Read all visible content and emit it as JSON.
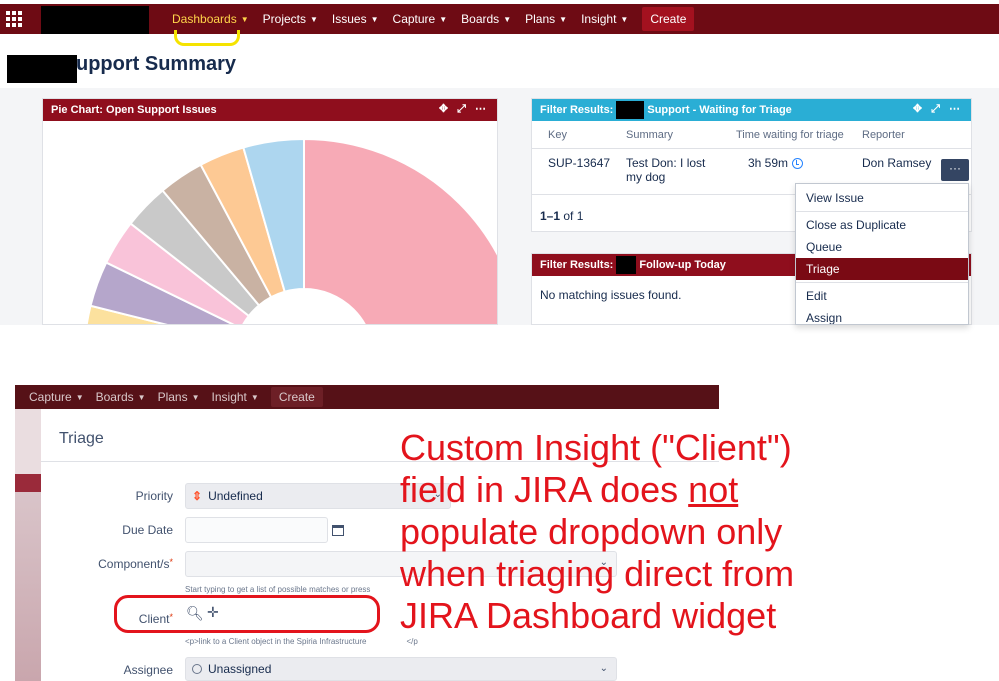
{
  "topnav": {
    "items": [
      {
        "label": "Dashboards",
        "active": true
      },
      {
        "label": "Projects"
      },
      {
        "label": "Issues"
      },
      {
        "label": "Capture"
      },
      {
        "label": "Boards"
      },
      {
        "label": "Plans"
      },
      {
        "label": "Insight"
      }
    ],
    "create_label": "Create"
  },
  "page": {
    "title": "upport Summary"
  },
  "pie_gadget": {
    "title": "Pie Chart: Open Support Issues",
    "tools": "✥ ⤢ ⋯",
    "colors": [
      "#f7aab6",
      "#add6ef",
      "#fdc994",
      "#c9b2a3",
      "#c9c9c9",
      "#f9c3d9",
      "#b5a6cb",
      "#fce19e",
      "#e9a19b"
    ]
  },
  "filter1": {
    "title_prefix": "Filter Results:",
    "title_suffix": "Support - Waiting for Triage",
    "tools": "✥ ⤢ ⋯",
    "columns": [
      "Key",
      "Summary",
      "Time waiting for triage",
      "Reporter"
    ],
    "row": {
      "key": "SUP-13647",
      "summary_line1": "Test Don: I lost",
      "summary_line2": "my dog",
      "time": "3h 59m",
      "reporter": "Don Ramsey",
      "action": "···"
    },
    "pager_range": "1–1",
    "pager_suffix": "of 1"
  },
  "filter2": {
    "title_prefix": "Filter Results:",
    "title_suffix": "Follow-up Today",
    "message": "No matching issues found."
  },
  "action_menu": {
    "group1": [
      "View Issue"
    ],
    "group2": [
      "Close as Duplicate",
      "Queue",
      "Triage"
    ],
    "group3": [
      "Edit",
      "Assign"
    ],
    "selected": "Triage"
  },
  "nav2": {
    "items": [
      "Capture",
      "Boards",
      "Plans",
      "Insight"
    ],
    "create_label": "Create"
  },
  "triage_dialog": {
    "title": "Triage",
    "priority_label": "Priority",
    "priority_value": "Undefined",
    "due_date_label": "Due Date",
    "component_label": "Component/s",
    "component_hint": "Start typing to get a list of possible matches or press",
    "client_label": "Client",
    "client_hint": "<p>link to a Client object in the Spiria Infrastructure",
    "client_hint_end": "</p",
    "assignee_label": "Assignee",
    "assignee_value": "Unassigned",
    "required_mark": "*"
  },
  "annotation": {
    "line1": "Custom Insight (\"Client\")",
    "line2_pre": "field in JIRA does ",
    "line2_underlined": "not",
    "line3": "populate dropdown only",
    "line4": "when triaging direct from",
    "line5": "JIRA Dashboard widget"
  }
}
